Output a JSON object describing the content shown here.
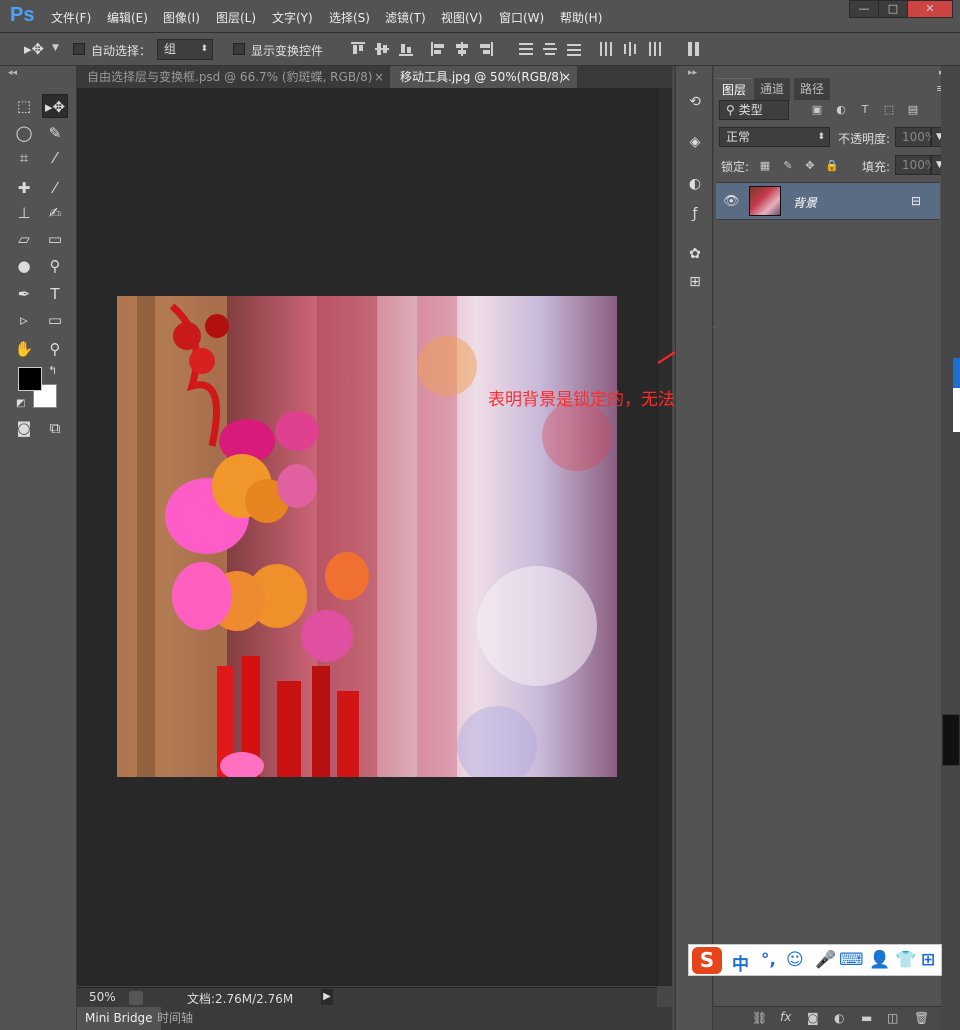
{
  "app": {
    "logo": "Ps"
  },
  "menu": [
    "文件(F)",
    "编辑(E)",
    "图像(I)",
    "图层(L)",
    "文字(Y)",
    "选择(S)",
    "滤镜(T)",
    "视图(V)",
    "窗口(W)",
    "帮助(H)"
  ],
  "window_buttons": {
    "minimize": "—",
    "restore": "□",
    "close": "✕"
  },
  "options": {
    "auto_select_label": "自动选择：",
    "auto_select_value": "组",
    "show_transform_label": "显示变换控件"
  },
  "tabs": [
    {
      "label": "自由选择层与变换框.psd @ 66.7% (豹斑蝶, RGB/8)",
      "close": "×",
      "active": false
    },
    {
      "label": "移动工具.jpg @ 50%(RGB/8)",
      "close": "×",
      "active": true
    }
  ],
  "status": {
    "zoom": "50%",
    "doc": "文档:2.76M/2.76M"
  },
  "bottom_tabs": [
    "Mini Bridge",
    "时间轴"
  ],
  "layers_panel": {
    "tabs": [
      "图层",
      "通道",
      "路径"
    ],
    "filter_label": "类型",
    "blend_mode": "正常",
    "opacity_label": "不透明度:",
    "opacity_value": "100%",
    "lock_label": "锁定:",
    "fill_label": "填充:",
    "fill_value": "100%",
    "layers": [
      {
        "name": "背景",
        "visible": true,
        "locked": true
      }
    ]
  },
  "annotation": {
    "text": "表明背景是锁定的，无法移动",
    "color": "#ff2a2a"
  },
  "ime": {
    "chinese_label": "中",
    "punct_label": "°,"
  },
  "colors": {
    "accent": "#4aa3ff",
    "selected_layer": "#5a6b84",
    "annotation": "#ff2a2a"
  }
}
